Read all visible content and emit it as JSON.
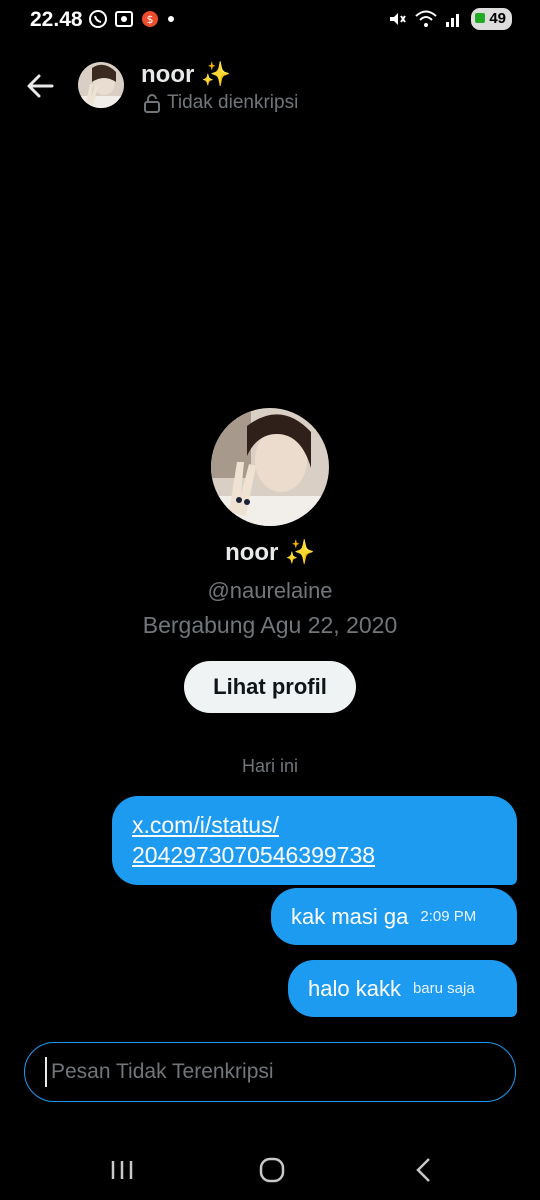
{
  "status_bar": {
    "time": "22.48",
    "battery": "49",
    "left_icons": [
      "whatsapp-icon",
      "screen-capture-icon",
      "shopee-icon",
      "dot-icon"
    ],
    "right_icons": [
      "mute-icon",
      "wifi-icon",
      "signal-icon"
    ]
  },
  "header": {
    "name": "noor ✨",
    "encryption_status": "Tidak dienkripsi"
  },
  "profile": {
    "name": "noor ✨",
    "handle": "@naurelaine",
    "joined": "Bergabung Agu 22, 2020",
    "view_profile_label": "Lihat profil"
  },
  "conversation": {
    "day_label": "Hari ini",
    "messages": [
      {
        "text": "x.com/i/status/\n2042973070546399738",
        "line1": "x.com/i/status/",
        "line2": "2042973070546399738",
        "time": ""
      },
      {
        "text": "kak masi ga",
        "time": "2:09 PM"
      },
      {
        "text": "halo kakk",
        "time": "baru saja"
      }
    ]
  },
  "composer": {
    "placeholder": "Pesan Tidak Terenkripsi"
  },
  "colors": {
    "accent": "#1d9bf0",
    "background": "#000000",
    "secondary_text": "#71767b"
  }
}
